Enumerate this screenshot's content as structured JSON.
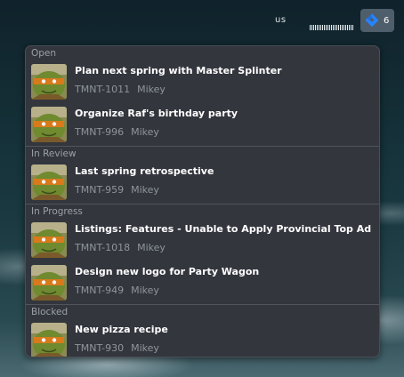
{
  "topbar": {
    "language": "us",
    "jira_count": "6"
  },
  "groups": [
    {
      "label": "Open",
      "items": [
        {
          "title": "Plan next spring with Master Splinter",
          "key": "TMNT-1011",
          "assignee": "Mikey"
        },
        {
          "title": "Organize Raf's birthday party",
          "key": "TMNT-996",
          "assignee": "Mikey"
        }
      ]
    },
    {
      "label": "In Review",
      "items": [
        {
          "title": "Last spring retrospective",
          "key": "TMNT-959",
          "assignee": "Mikey"
        }
      ]
    },
    {
      "label": "In Progress",
      "items": [
        {
          "title": "Listings:  Features - Unable to Apply Provincial Top Ad",
          "key": "TMNT-1018",
          "assignee": "Mikey"
        },
        {
          "title": "Design new logo for Party Wagon",
          "key": "TMNT-949",
          "assignee": "Mikey"
        }
      ]
    },
    {
      "label": "Blocked",
      "items": [
        {
          "title": "New pizza recipe",
          "key": "TMNT-930",
          "assignee": "Mikey"
        }
      ]
    }
  ],
  "icons": {
    "jira": "jira-logo-icon",
    "avatar": "turtle-avatar-icon"
  },
  "colors": {
    "panel_bg": "#33363d",
    "jira_button_bg": "#4f5e6b",
    "jira_blue": "#2684ff"
  }
}
